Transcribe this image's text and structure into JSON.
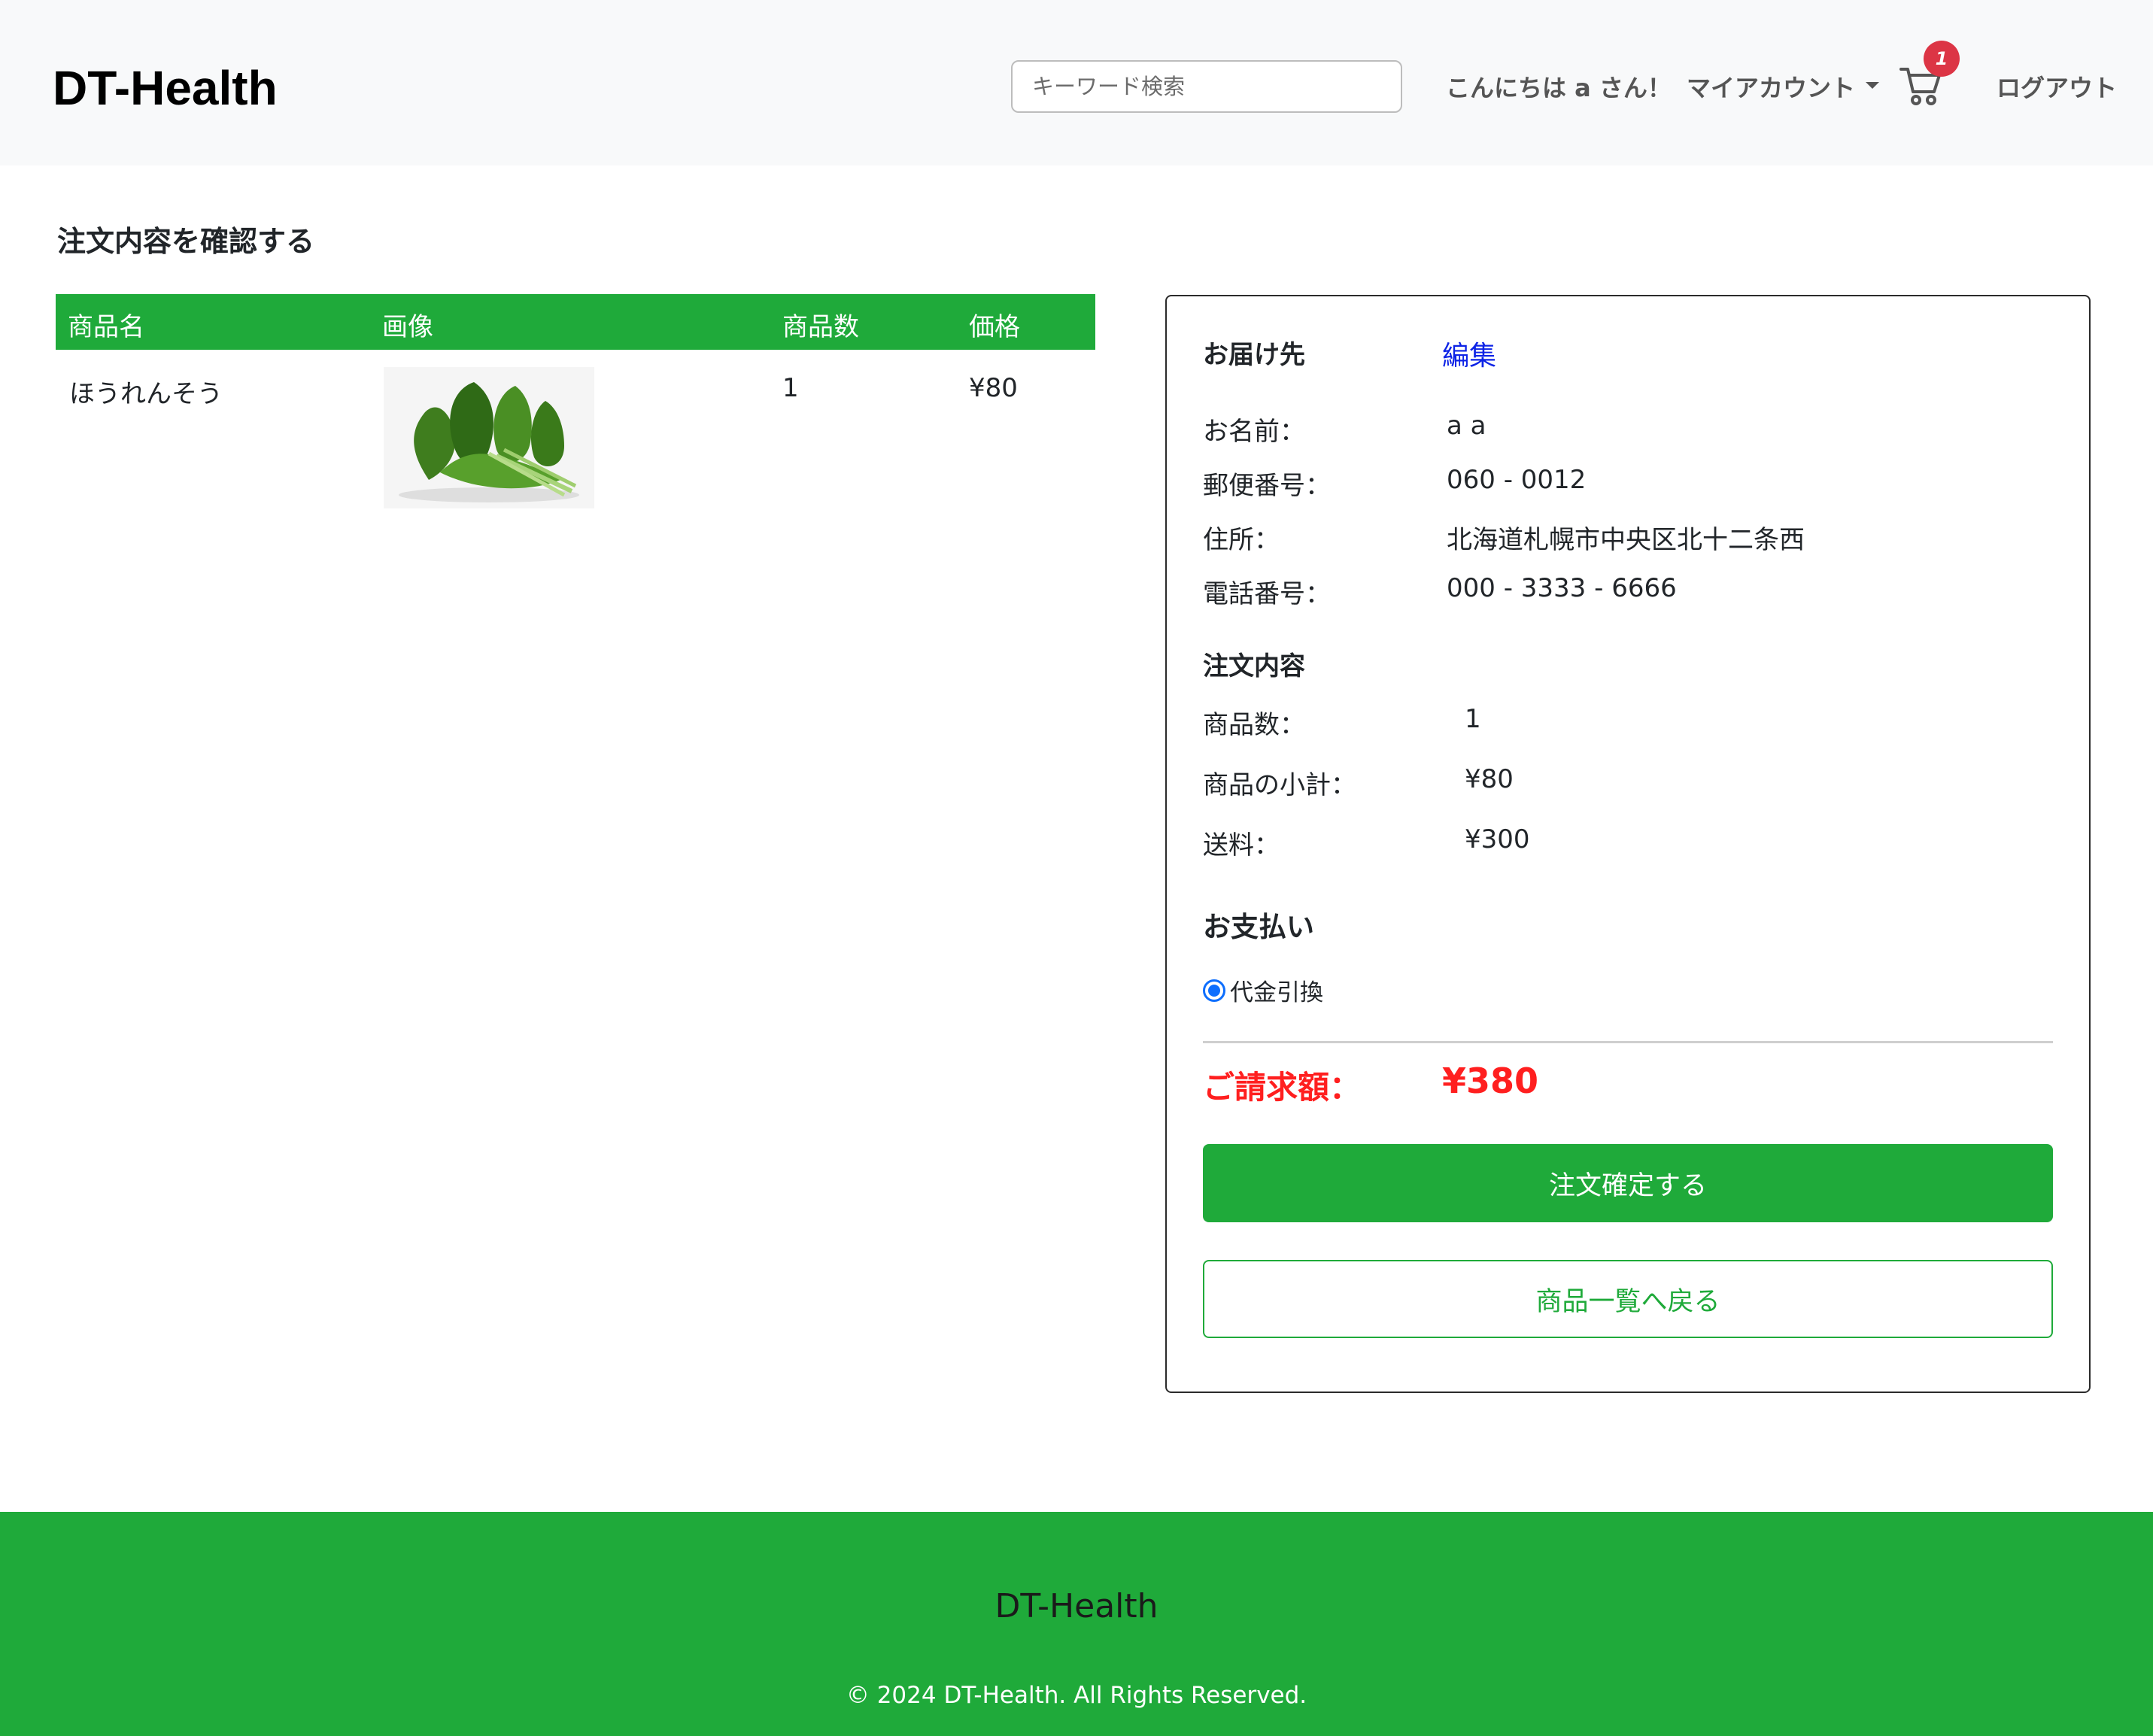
{
  "navbar": {
    "brand": "DT-Health",
    "search_placeholder": "キーワード検索",
    "greeting": "こんにちは a さん！",
    "account_label": "マイアカウント",
    "cart_count": "1",
    "logout_label": "ログアウト"
  },
  "page": {
    "title": "注文内容を確認する"
  },
  "cart_table": {
    "headers": [
      "商品名",
      "画像",
      "商品数",
      "価格"
    ],
    "rows": [
      {
        "name": "ほうれんそう",
        "image_alt": "spinach",
        "quantity": "1",
        "price": "¥80"
      }
    ]
  },
  "summary": {
    "delivery_title": "お届け先",
    "edit_label": "編集",
    "name_label": "お名前：",
    "name_value": "a a",
    "postal_label": "郵便番号：",
    "postal_value": "060 - 0012",
    "address_label": "住所：",
    "address_value": "北海道札幌市中央区北十二条西",
    "phone_label": "電話番号：",
    "phone_value": "000 - 3333 - 6666",
    "order_title": "注文内容",
    "qty_label": "商品数：",
    "qty_value": "1",
    "subtotal_label": "商品の小計：",
    "subtotal_value": "¥80",
    "shipping_label": "送料：",
    "shipping_value": "¥300",
    "payment_title": "お支払い",
    "payment_option": "代金引換",
    "bill_label": "ご請求額：",
    "bill_value": "¥380",
    "confirm_button": "注文確定する",
    "back_button": "商品一覧へ戻る"
  },
  "footer": {
    "brand": "DT-Health",
    "copyright": "© 2024 DT-Health. All Rights Reserved."
  },
  "colors": {
    "accent_green": "#1faa3a",
    "bill_red": "#ff1f1f",
    "link_blue": "#0d23e6",
    "badge_red": "#dc3545"
  }
}
